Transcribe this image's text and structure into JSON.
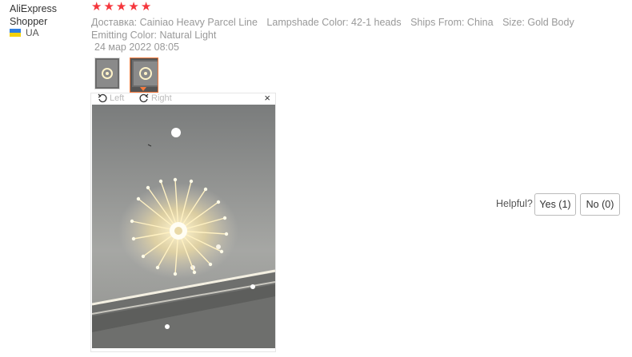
{
  "reviewer": {
    "name": "AliExpress Shopper",
    "country": "UA",
    "flag_colors": [
      "#2f7fe0",
      "#f5d20a"
    ]
  },
  "rating": {
    "stars": 5,
    "color": "#f5363c"
  },
  "attributes": [
    "Доставка: Cainiao Heavy Parcel Line",
    "Lampshade Color: 42-1 heads",
    "Ships From: China",
    "Size: Gold Body",
    "Emitting Color: Natural Light"
  ],
  "date": "24 мар 2022 08:05",
  "thumbnails": {
    "count": 2,
    "selected_index": 1,
    "selected_color": "#f97a3c"
  },
  "viewer": {
    "rotate_left": "Left",
    "rotate_right": "Right",
    "close": "×"
  },
  "helpful": {
    "label": "Helpful?",
    "yes": "Yes (1)",
    "no": "No (0)"
  }
}
